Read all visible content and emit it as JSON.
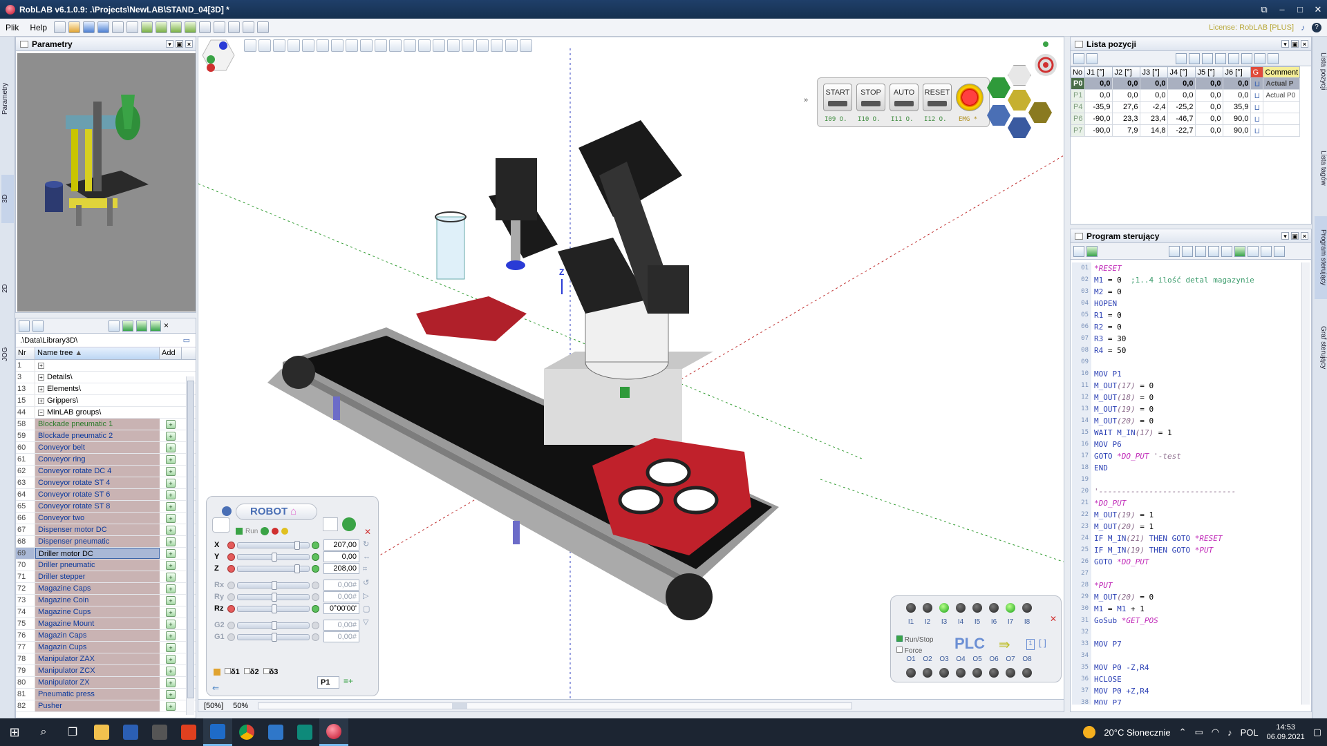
{
  "app": {
    "title": "RobLAB v6.1.0.9:   .\\Projects\\NewLAB\\STAND_04[3D] *",
    "license": "License: RobLAB [PLUS]"
  },
  "menu": {
    "file": "Plik",
    "help": "Help"
  },
  "left": {
    "param_title": "Parametry",
    "tab_param": "Parametry",
    "tab_3d": "3D",
    "tab_2d": "2D",
    "tab_jog": "JOG"
  },
  "library": {
    "path": ".\\Data\\Library3D\\",
    "col_nr": "Nr",
    "col_name": "Name tree",
    "col_add": "Add",
    "rows": [
      {
        "nr": "1",
        "name": "",
        "kind": "fold"
      },
      {
        "nr": "3",
        "name": "Details\\",
        "kind": "fold"
      },
      {
        "nr": "13",
        "name": "Elements\\",
        "kind": "fold"
      },
      {
        "nr": "15",
        "name": "Grippers\\",
        "kind": "fold"
      },
      {
        "nr": "44",
        "name": "MinLAB groups\\",
        "kind": "open"
      },
      {
        "nr": "58",
        "name": "Blockade pneumatic 1",
        "kind": "green"
      },
      {
        "nr": "59",
        "name": "Blockade pneumatic 2",
        "kind": "item"
      },
      {
        "nr": "60",
        "name": "Conveyor belt",
        "kind": "item"
      },
      {
        "nr": "61",
        "name": "Conveyor ring",
        "kind": "item"
      },
      {
        "nr": "62",
        "name": "Conveyor rotate DC 4",
        "kind": "item"
      },
      {
        "nr": "63",
        "name": "Conveyor rotate ST 4",
        "kind": "item"
      },
      {
        "nr": "64",
        "name": "Conveyor rotate ST 6",
        "kind": "item"
      },
      {
        "nr": "65",
        "name": "Conveyor rotate ST 8",
        "kind": "item"
      },
      {
        "nr": "66",
        "name": "Conveyor two",
        "kind": "item"
      },
      {
        "nr": "67",
        "name": "Dispenser motor DC",
        "kind": "item"
      },
      {
        "nr": "68",
        "name": "Dispenser pneumatic",
        "kind": "item"
      },
      {
        "nr": "69",
        "name": "Driller motor DC",
        "kind": "sel"
      },
      {
        "nr": "70",
        "name": "Driller pneumatic",
        "kind": "item"
      },
      {
        "nr": "71",
        "name": "Driller stepper",
        "kind": "item"
      },
      {
        "nr": "72",
        "name": "Magazine Caps",
        "kind": "item"
      },
      {
        "nr": "73",
        "name": "Magazine Coin",
        "kind": "item"
      },
      {
        "nr": "74",
        "name": "Magazine Cups",
        "kind": "item"
      },
      {
        "nr": "75",
        "name": "Magazine Mount",
        "kind": "item"
      },
      {
        "nr": "76",
        "name": "Magazin Caps",
        "kind": "item"
      },
      {
        "nr": "77",
        "name": "Magazin Cups",
        "kind": "item"
      },
      {
        "nr": "78",
        "name": "Manipulator ZAX",
        "kind": "item"
      },
      {
        "nr": "79",
        "name": "Manipulator ZCX",
        "kind": "item"
      },
      {
        "nr": "80",
        "name": "Manipulator ZX",
        "kind": "item"
      },
      {
        "nr": "81",
        "name": "Pneumatic press",
        "kind": "item"
      },
      {
        "nr": "82",
        "name": "Pusher",
        "kind": "item"
      }
    ]
  },
  "control": {
    "start": "START",
    "stop": "STOP",
    "auto": "AUTO",
    "reset": "RESET",
    "io1": "I09 O.",
    "io2": "I10 O.",
    "io3": "I11 O.",
    "io4": "I12 O.",
    "emg": "EMG *"
  },
  "robot": {
    "title": "ROBOT",
    "run": "Run",
    "axes": [
      {
        "label": "X",
        "value": "207,00",
        "pos": 0.85,
        "dim": false
      },
      {
        "label": "Y",
        "value": "0,00",
        "pos": 0.5,
        "dim": false
      },
      {
        "label": "Z",
        "value": "208,00",
        "pos": 0.85,
        "dim": false
      },
      {
        "label": "Rx",
        "value": "0,00#",
        "pos": 0.5,
        "dim": true
      },
      {
        "label": "Ry",
        "value": "0,00#",
        "pos": 0.5,
        "dim": true
      },
      {
        "label": "Rz",
        "value": "0°00'00'",
        "pos": 0.5,
        "dim": false
      },
      {
        "label": "G2",
        "value": "0,00#",
        "pos": 0.5,
        "dim": true
      },
      {
        "label": "G1",
        "value": "0,00#",
        "pos": 0.5,
        "dim": true
      }
    ],
    "d1": "δ1",
    "d2": "δ2",
    "d3": "δ3",
    "point": "P1"
  },
  "scene": {
    "z_label": "Z"
  },
  "plc": {
    "title": "PLC",
    "runstop": "Run/Stop",
    "force": "Force",
    "inputs": [
      "I1",
      "I2",
      "I3",
      "I4",
      "I5",
      "I6",
      "I7",
      "I8"
    ],
    "outputs": [
      "O1",
      "O2",
      "O3",
      "O4",
      "O5",
      "O6",
      "O7",
      "O8"
    ],
    "input_on": [
      false,
      false,
      true,
      false,
      false,
      false,
      true,
      false
    ],
    "output_on": [
      false,
      false,
      false,
      false,
      false,
      false,
      false,
      false
    ]
  },
  "viewport_status": {
    "zoom1": "[50%]",
    "zoom2": "50%"
  },
  "lista": {
    "title": "Lista pozycji",
    "cols": [
      "No",
      "J1 [°]",
      "J2 [°]",
      "J3 [°]",
      "J4 [°]",
      "J5 [°]",
      "J6 [°]",
      "G",
      "Comment"
    ],
    "rows": [
      {
        "no": "P0",
        "v": [
          "0,0",
          "0,0",
          "0,0",
          "0,0",
          "0,0",
          "0,0"
        ],
        "c": "Actual P"
      },
      {
        "no": "P1",
        "v": [
          "0,0",
          "0,0",
          "0,0",
          "0,0",
          "0,0",
          "0,0"
        ],
        "c": "Actual P0"
      },
      {
        "no": "P4",
        "v": [
          "-35,9",
          "27,6",
          "-2,4",
          "-25,2",
          "0,0",
          "35,9"
        ],
        "c": ""
      },
      {
        "no": "P6",
        "v": [
          "-90,0",
          "23,3",
          "23,4",
          "-46,7",
          "0,0",
          "90,0"
        ],
        "c": ""
      },
      {
        "no": "P7",
        "v": [
          "-90,0",
          "7,9",
          "14,8",
          "-22,7",
          "0,0",
          "90,0"
        ],
        "c": ""
      }
    ]
  },
  "program": {
    "title": "Program sterujący",
    "lines": [
      {
        "n": "01",
        "h": "<span class='lab'>*RESET</span>"
      },
      {
        "n": "02",
        "h": "<span class='kw'>M1</span> = 0  <span class='cm2'>;1..4 ilość detal magazynie</span>"
      },
      {
        "n": "03",
        "h": "<span class='kw'>M2</span> = 0"
      },
      {
        "n": "04",
        "h": "<span class='kw'>HOPEN</span>"
      },
      {
        "n": "05",
        "h": "<span class='kw'>R1</span> = 0"
      },
      {
        "n": "06",
        "h": "<span class='kw'>R2</span> = 0"
      },
      {
        "n": "07",
        "h": "<span class='kw'>R3</span> = 30"
      },
      {
        "n": "08",
        "h": "<span class='kw'>R4</span> = 50"
      },
      {
        "n": "09",
        "h": ""
      },
      {
        "n": "10",
        "h": "<span class='kw'>MOV P1</span>"
      },
      {
        "n": "11",
        "h": "<span class='kw'>M_OUT</span><span class='it'>(17)</span> = 0"
      },
      {
        "n": "12",
        "h": "<span class='kw'>M_OUT</span><span class='it'>(18)</span> = 0"
      },
      {
        "n": "13",
        "h": "<span class='kw'>M_OUT</span><span class='it'>(19)</span> = 0"
      },
      {
        "n": "14",
        "h": "<span class='kw'>M_OUT</span><span class='it'>(20)</span> = 0"
      },
      {
        "n": "15",
        "h": "<span class='kw'>WAIT M_IN</span><span class='it'>(17)</span> = 1"
      },
      {
        "n": "16",
        "h": "<span class='kw'>MOV P6</span>"
      },
      {
        "n": "17",
        "h": "<span class='kw'>GOTO</span> <span class='lab'>*DO_PUT</span> <span class='it'>'-test</span>"
      },
      {
        "n": "18",
        "h": "<span class='kw'>END</span>"
      },
      {
        "n": "19",
        "h": ""
      },
      {
        "n": "20",
        "h": "<span class='it'>'------------------------------</span>"
      },
      {
        "n": "21",
        "h": "<span class='lab'>*DO_PUT</span>"
      },
      {
        "n": "22",
        "h": "<span class='kw'>M_OUT</span><span class='it'>(19)</span> = 1"
      },
      {
        "n": "23",
        "h": "<span class='kw'>M_OUT</span><span class='it'>(20)</span> = 1"
      },
      {
        "n": "24",
        "h": "<span class='kw'>IF M_IN</span><span class='it'>(21)</span> <span class='kw'>THEN GOTO</span> <span class='lab'>*RESET</span>"
      },
      {
        "n": "25",
        "h": "<span class='kw'>IF M_IN</span><span class='it'>(19)</span> <span class='kw'>THEN GOTO</span> <span class='lab'>*PUT</span>"
      },
      {
        "n": "26",
        "h": "<span class='kw'>GOTO</span> <span class='lab'>*DO_PUT</span>"
      },
      {
        "n": "27",
        "h": ""
      },
      {
        "n": "28",
        "h": "<span class='lab'>*PUT</span>"
      },
      {
        "n": "29",
        "h": "<span class='kw'>M_OUT</span><span class='it'>(20)</span> = 0"
      },
      {
        "n": "30",
        "h": "<span class='kw'>M1</span> = <span class='kw'>M1</span> + 1"
      },
      {
        "n": "31",
        "h": "<span class='kw'>GoSub</span> <span class='lab'>*GET_POS</span>"
      },
      {
        "n": "32",
        "h": ""
      },
      {
        "n": "33",
        "h": "<span class='kw'>MOV P7</span>"
      },
      {
        "n": "34",
        "h": ""
      },
      {
        "n": "35",
        "h": "<span class='kw'>MOV P0 -Z,R4</span>"
      },
      {
        "n": "36",
        "h": "<span class='kw'>HCLOSE</span>"
      },
      {
        "n": "37",
        "h": "<span class='kw'>MOV P0 +Z,R4</span>"
      },
      {
        "n": "38",
        "h": "<span class='kw'>MOV P7</span>"
      }
    ]
  },
  "right_tabs": {
    "t1": "Lista pozycji",
    "t2": "Lista tagów",
    "t3": "Program sterujący",
    "t4": "Graf sterujący"
  },
  "taskbar": {
    "weather": "20°C Słonecznie",
    "lang": "POL",
    "time": "14:53",
    "date": "06.09.2021"
  }
}
